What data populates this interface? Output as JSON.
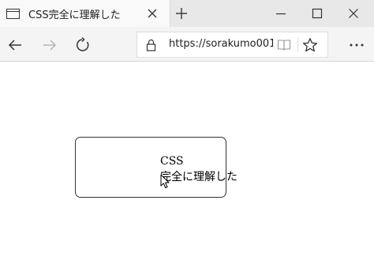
{
  "tab": {
    "title": "CSS完全に理解した",
    "icon": "page-tab-icon",
    "close_icon": "close-icon"
  },
  "tabstrip": {
    "new_tab_icon": "plus-icon"
  },
  "window_controls": {
    "minimize_icon": "minimize-icon",
    "maximize_icon": "maximize-icon",
    "close_icon": "close-icon"
  },
  "navbar": {
    "back_icon": "back-arrow-icon",
    "forward_icon": "forward-arrow-icon",
    "refresh_icon": "refresh-icon",
    "address": {
      "url": "https://sorakumo001",
      "lock_icon": "lock-icon",
      "reading_view_icon": "reading-view-icon",
      "favorite_icon": "star-icon"
    },
    "more_icon": "more-dots-icon"
  },
  "page": {
    "box_lines": [
      "CSS",
      "完全に理解した"
    ]
  },
  "colors": {
    "tabstrip_bg": "#e8e8e8",
    "active_tab_bg": "#f9f9f9",
    "navbar_bg": "#f4f4f4",
    "disabled_icon": "#b4b4b4",
    "icon": "#333333",
    "box_border": "#333333"
  }
}
